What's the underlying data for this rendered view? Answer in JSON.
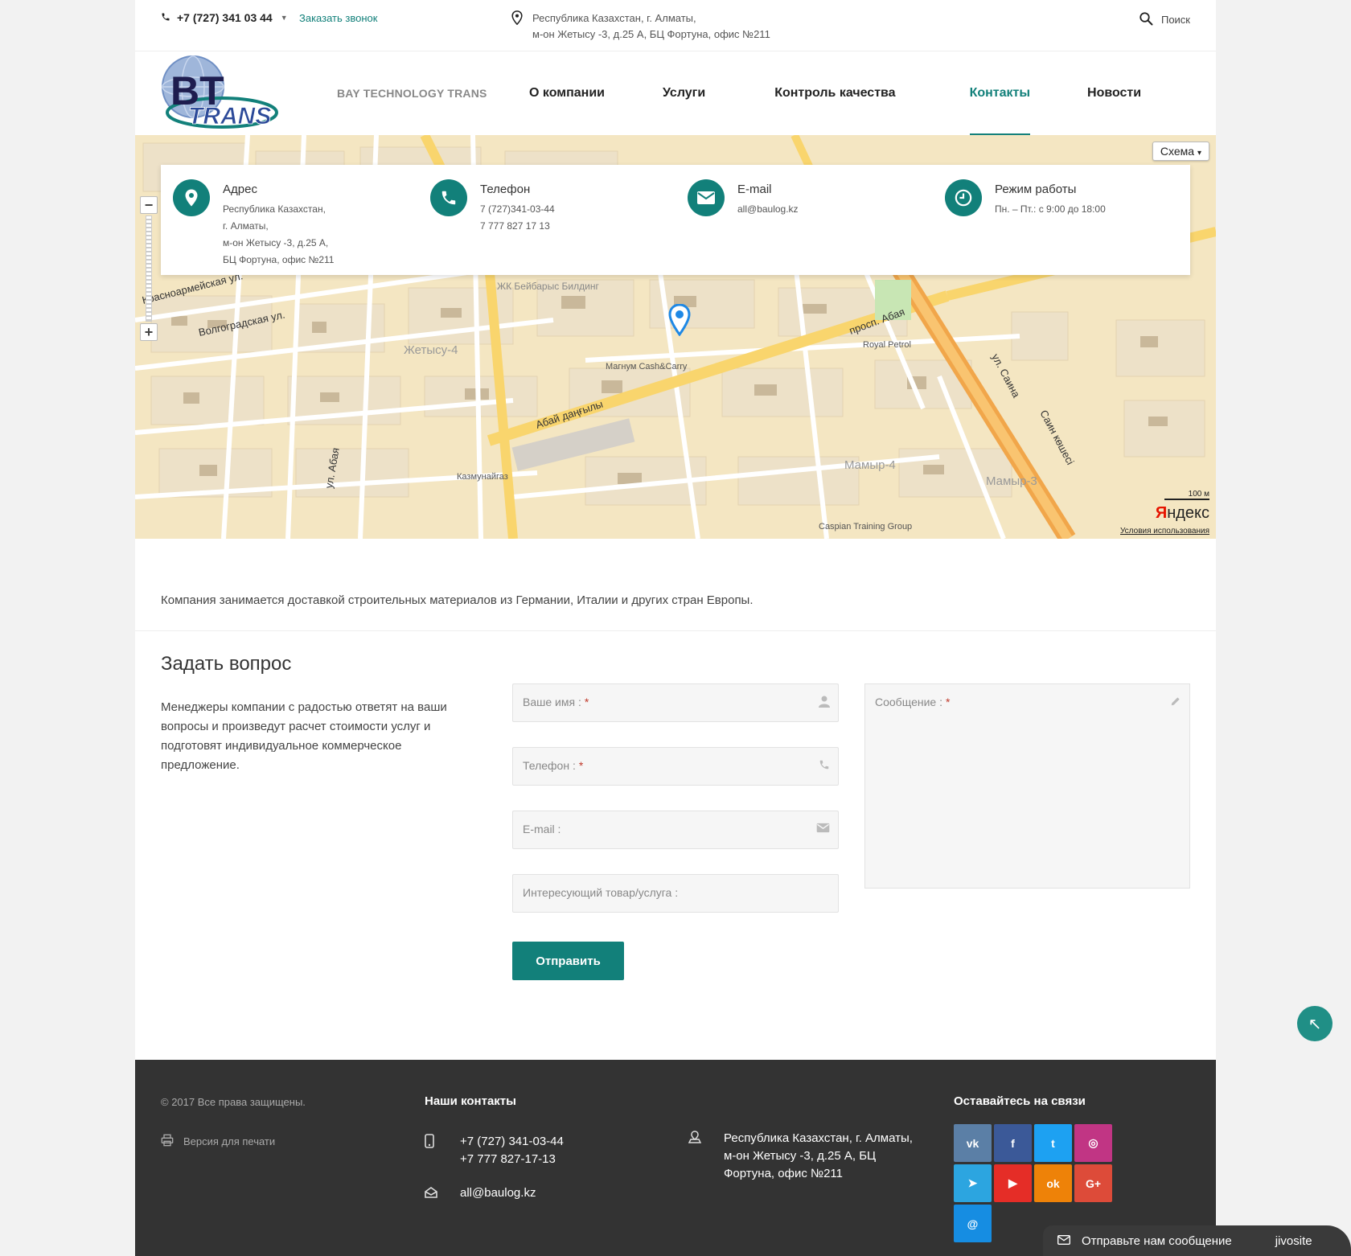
{
  "topbar": {
    "phone": "+7 (727) 341 03 44",
    "callback": "Заказать звонок",
    "address_line1": "Республика Казахстан, г. Алматы,",
    "address_line2": "м-он Жетысу -3, д.25 А, БЦ Фортуна, офис №211",
    "search": "Поиск"
  },
  "header": {
    "logo_top": "BT",
    "logo_bottom": "TRANS",
    "brand": "BAY TECHNOLOGY TRANS",
    "nav": [
      "О компании",
      "Услуги",
      "Контроль качества",
      "Контакты",
      "Новости"
    ],
    "active": "Контакты"
  },
  "map": {
    "scheme": "Схема",
    "scheme_caret": "▾",
    "zoom_out": "−",
    "zoom_in": "+",
    "scale": "100 м",
    "logo_ya": "Я",
    "logo_rest": "ндекс",
    "terms": "Условия использования",
    "labels": [
      "Магнум Cash&Carry",
      "Royal Petrol",
      "Казмунайгаз",
      "Caspian Training Group",
      "Мамыр-4",
      "Мамыр-3",
      "Жетысу-4",
      "просп. Абая",
      "Абай даңғылы",
      "ул. Саина",
      "Саин көшесі",
      "ул. Абая",
      "ЖК Бейбарыс Билдинг",
      "Волгоградская ул.",
      "Красноармейская ул."
    ],
    "colors": {
      "land": "#f4e6c2",
      "road": "#ffffff",
      "major": "#f9d56d",
      "highway": "#f1a64a",
      "block": "#ede1c8",
      "text": "#555555"
    }
  },
  "contacts": {
    "address_title": "Адрес",
    "address_lines": [
      "Республика Казахстан,",
      "г. Алматы,",
      "м-он Жетысу -3, д.25 А,",
      "БЦ Фортуна, офис №211"
    ],
    "phone_title": "Телефон",
    "phone_lines": [
      "7 (727)341-03-44",
      "7 777 827 17 13"
    ],
    "email_title": "E-mail",
    "email": "all@baulog.kz",
    "hours_title": "Режим работы",
    "hours": "Пн. – Пт.: с 9:00 до 18:00"
  },
  "intro": "Компания занимается доставкой строительных материалов из Германии, Италии и других стран Европы.",
  "form": {
    "title": "Задать вопрос",
    "text": "Менеджеры компании с радостью ответят на ваши вопросы и произведут расчет стоимости услуг и подготовят индивидуальное коммерческое предложение.",
    "name": "Ваше имя :",
    "phone": "Телефон :",
    "email": "E-mail :",
    "product": "Интересующий товар/услуга :",
    "message": "Сообщение :",
    "required": "*",
    "submit": "Отправить"
  },
  "scrolltop": "↖",
  "footer": {
    "copyright": "© 2017 Все права защищены.",
    "print": "Версия для печати",
    "contacts_title": "Наши контакты",
    "phone1": "+7 (727) 341-03-44",
    "phone2": "+7 777 827-17-13",
    "email": "all@baulog.kz",
    "addr1": "Республика Казахстан, г. Алматы,",
    "addr2": "м-он Жетысу -3, д.25 А, БЦ",
    "addr3": "Фортуна, офис №211",
    "social_title": "Оставайтесь на связи",
    "socials": [
      {
        "name": "vk",
        "glyph": "vk",
        "color": "#5b7fa6"
      },
      {
        "name": "facebook",
        "glyph": "f",
        "color": "#3b5998"
      },
      {
        "name": "twitter",
        "glyph": "t",
        "color": "#1da1f2"
      },
      {
        "name": "instagram",
        "glyph": "◎",
        "color": "#c13584"
      },
      {
        "name": "telegram",
        "glyph": "➤",
        "color": "#2ca5e0"
      },
      {
        "name": "youtube",
        "glyph": "▶",
        "color": "#e52d27"
      },
      {
        "name": "odnoklassniki",
        "glyph": "ok",
        "color": "#ee8208"
      },
      {
        "name": "google-plus",
        "glyph": "G+",
        "color": "#dd4b39"
      },
      {
        "name": "mail",
        "glyph": "@",
        "color": "#168de2"
      }
    ]
  },
  "jivo": {
    "text": "Отправьте нам сообщение",
    "brand": "jivosite"
  }
}
